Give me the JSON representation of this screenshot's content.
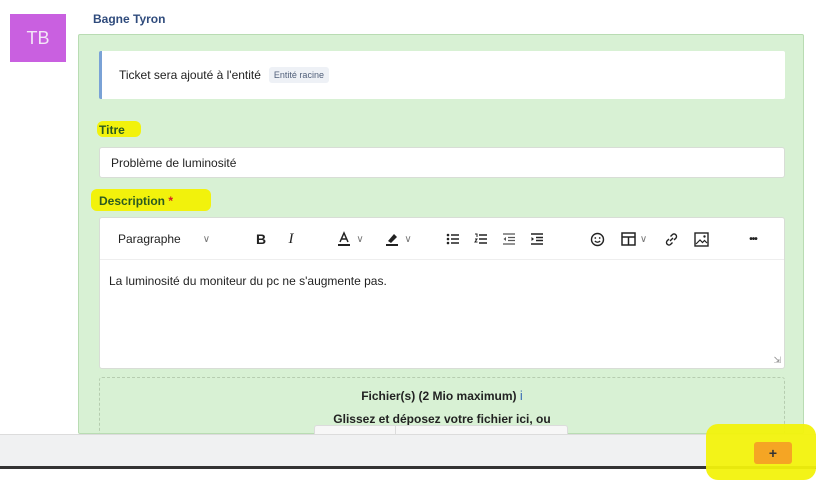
{
  "author": {
    "initials": "TB",
    "name": "Bagne Tyron"
  },
  "info": {
    "text": "Ticket sera ajouté à l'entité",
    "badge": "Entité racine"
  },
  "title_field": {
    "label": "Titre",
    "value": "Problème de luminosité"
  },
  "description": {
    "label": "Description",
    "required_mark": "*",
    "text": "La luminosité du moniteur du pc ne s'augmente pas."
  },
  "toolbar": {
    "block_format": "Paragraphe",
    "bold": "B",
    "italic": "I",
    "more": "•••",
    "icons": [
      "text-color-icon",
      "highlight-color-icon",
      "bulleted-list-icon",
      "numbered-list-icon",
      "outdent-icon",
      "indent-icon",
      "emoji-icon",
      "table-icon",
      "link-icon",
      "image-icon"
    ]
  },
  "dropzone": {
    "title": "Fichier(s) (2 Mio maximum)",
    "info_icon": "i",
    "subtitle": "Glissez et déposez votre fichier ici, ou"
  },
  "add_button": {
    "label": "+",
    "color": "#f5a524"
  },
  "colors": {
    "card": "#d8f1d4",
    "avatar": "#c960e0",
    "highlight": "#f2f20c"
  }
}
